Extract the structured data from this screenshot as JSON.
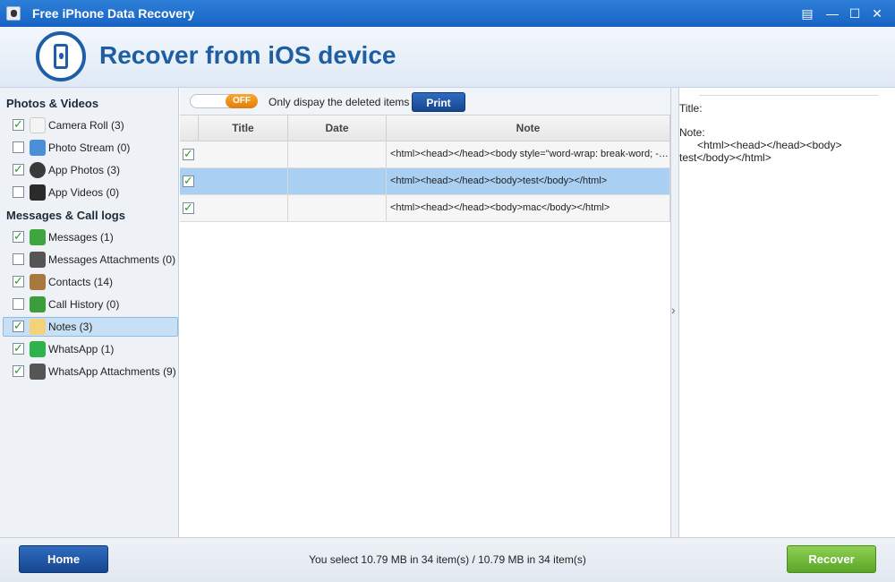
{
  "window": {
    "title": "Free iPhone Data Recovery"
  },
  "header": {
    "title": "Recover from iOS device"
  },
  "sidebar": {
    "sections": [
      {
        "title": "Photos & Videos",
        "items": [
          {
            "label": "Camera Roll (3)",
            "checked": true,
            "icon": "camera-roll-icon",
            "color": "#f4f4f4"
          },
          {
            "label": "Photo Stream (0)",
            "checked": false,
            "icon": "photo-stream-icon",
            "color": "#4a90d9"
          },
          {
            "label": "App Photos (3)",
            "checked": true,
            "icon": "app-photos-icon",
            "color": "#3a3a3a"
          },
          {
            "label": "App Videos (0)",
            "checked": false,
            "icon": "app-videos-icon",
            "color": "#2b2b2b"
          }
        ]
      },
      {
        "title": "Messages & Call logs",
        "items": [
          {
            "label": "Messages (1)",
            "checked": true,
            "icon": "messages-icon",
            "color": "#3fa53f"
          },
          {
            "label": "Messages Attachments (0)",
            "checked": false,
            "icon": "attachment-icon",
            "color": "#555555"
          },
          {
            "label": "Contacts (14)",
            "checked": true,
            "icon": "contacts-icon",
            "color": "#a8783f"
          },
          {
            "label": "Call History (0)",
            "checked": false,
            "icon": "call-history-icon",
            "color": "#3a9e3a"
          },
          {
            "label": "Notes (3)",
            "checked": true,
            "icon": "notes-icon",
            "color": "#f3d27a",
            "selected": true
          },
          {
            "label": "WhatsApp (1)",
            "checked": true,
            "icon": "whatsapp-icon",
            "color": "#2eb34b"
          },
          {
            "label": "WhatsApp Attachments (9)",
            "checked": true,
            "icon": "attachment-icon",
            "color": "#555555"
          }
        ]
      }
    ]
  },
  "toolbar": {
    "toggle_label": "OFF",
    "option_text": "Only dispay the deleted items",
    "print_label": "Print"
  },
  "table": {
    "columns": [
      "Title",
      "Date",
      "Note"
    ],
    "rows": [
      {
        "checked": true,
        "title": "",
        "date": "",
        "note": "<html><head></head><body style=\"word-wrap: break-word; -webkit-nbsp-mode: space;\">",
        "selected": false
      },
      {
        "checked": true,
        "title": "",
        "date": "",
        "note": "<html><head></head><body>test</body></html>",
        "selected": true
      },
      {
        "checked": true,
        "title": "",
        "date": "",
        "note": "<html><head></head><body>mac</body></html>",
        "selected": false
      }
    ]
  },
  "preview": {
    "title_label": "Title:",
    "note_label": "Note:",
    "note_line1": "      <html><head></head><body>",
    "note_line2": "test</body></html>"
  },
  "footer": {
    "home_label": "Home",
    "status": "You select 10.79 MB in 34 item(s) / 10.79 MB in 34 item(s)",
    "recover_label": "Recover"
  }
}
